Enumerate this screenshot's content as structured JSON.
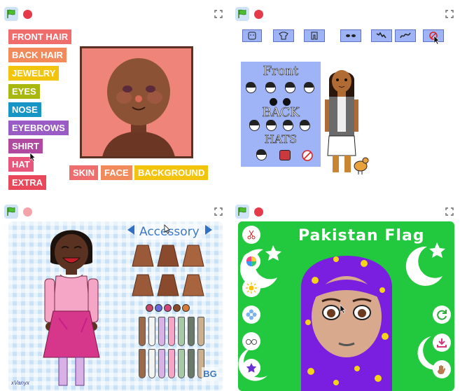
{
  "panel1": {
    "tags": [
      {
        "label": "FRONT HAIR",
        "color": "#ef6d6d"
      },
      {
        "label": "BACK HAIR",
        "color": "#f28a5c"
      },
      {
        "label": "JEWELRY",
        "color": "#f2c40c"
      },
      {
        "label": "EYES",
        "color": "#a9b80e"
      },
      {
        "label": "NOSE",
        "color": "#1796c6"
      },
      {
        "label": "EYEBROWS",
        "color": "#9a5bc4"
      },
      {
        "label": "SHIRT",
        "color": "#b04aa0"
      },
      {
        "label": "HAT",
        "color": "#e9567c"
      },
      {
        "label": "EXTRA",
        "color": "#e8485a"
      }
    ],
    "bottom_tags": [
      {
        "label": "SKIN",
        "color": "#ef6d6d"
      },
      {
        "label": "FACE",
        "color": "#f28a5c"
      },
      {
        "label": "BACKGROUND",
        "color": "#f2c40c"
      }
    ]
  },
  "panel2": {
    "menu_front": "Front",
    "menu_back": "BACK",
    "menu_hats": "HATS"
  },
  "panel3": {
    "title": "Accessory",
    "bg_button": "BG",
    "credit": "xVanyx"
  },
  "panel4": {
    "title": "Pakistan Flag"
  }
}
